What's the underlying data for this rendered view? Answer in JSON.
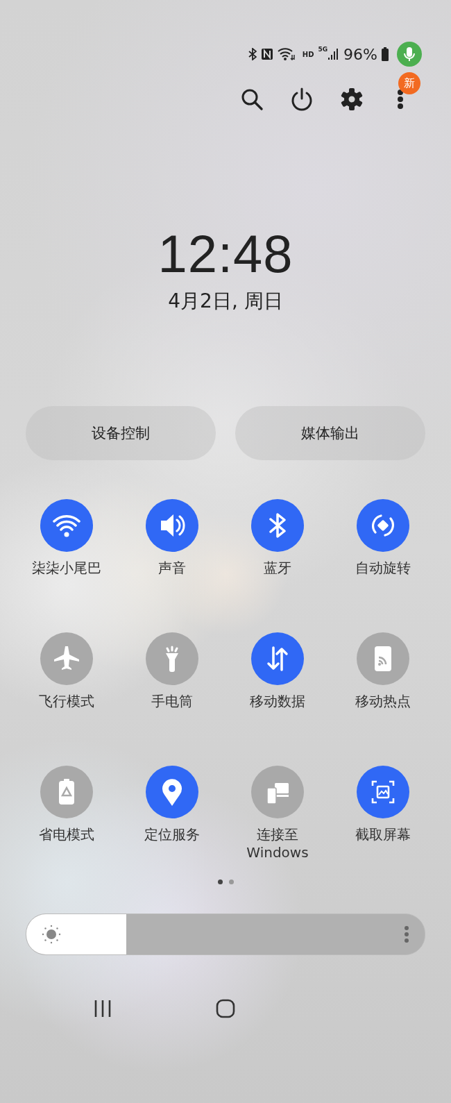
{
  "status_bar": {
    "battery": "96%",
    "network": "5G",
    "hd": "HD"
  },
  "quick_actions": {
    "badge": "新"
  },
  "clock": {
    "time": "12:48",
    "date": "4月2日, 周日"
  },
  "panels": [
    {
      "label": "设备控制"
    },
    {
      "label": "媒体输出"
    }
  ],
  "tiles": [
    {
      "kind": "wifi",
      "label": "柒柒小尾巴",
      "on": true
    },
    {
      "kind": "sound",
      "label": "声音",
      "on": true
    },
    {
      "kind": "bluetooth",
      "label": "蓝牙",
      "on": true
    },
    {
      "kind": "rotate",
      "label": "自动旋转",
      "on": true
    },
    {
      "kind": "airplane",
      "label": "飞行模式",
      "on": false
    },
    {
      "kind": "flashlight",
      "label": "手电筒",
      "on": false
    },
    {
      "kind": "data",
      "label": "移动数据",
      "on": true
    },
    {
      "kind": "hotspot",
      "label": "移动热点",
      "on": false
    },
    {
      "kind": "battery",
      "label": "省电模式",
      "on": false
    },
    {
      "kind": "location",
      "label": "定位服务",
      "on": true
    },
    {
      "kind": "windows",
      "label": "连接至 Windows",
      "on": false
    },
    {
      "kind": "screenshot",
      "label": "截取屏幕",
      "on": true
    }
  ],
  "pages": [
    {
      "selected": true
    },
    {
      "selected": false
    }
  ],
  "brightness": {
    "level": 0.25
  }
}
